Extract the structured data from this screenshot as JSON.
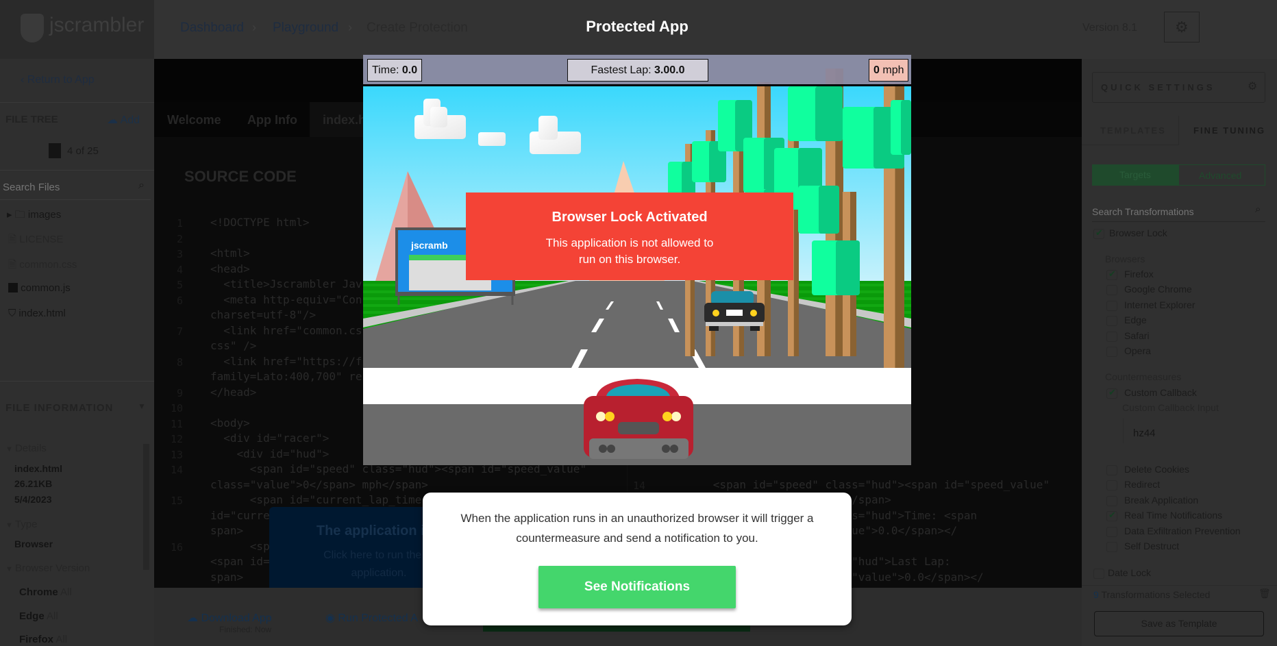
{
  "header": {
    "logo_text": "jscrambler",
    "breadcrumbs": [
      "Dashboard",
      "Playground",
      "Create Protection"
    ],
    "version": "Version 8.1"
  },
  "sidebar": {
    "return_label": "Return to App",
    "file_tree_title": "FILE TREE",
    "add_label": "Add",
    "file_count": "4 of 25",
    "search_placeholder": "Search Files",
    "files": [
      "images",
      "LICENSE",
      "common.css",
      "common.js",
      "index.html"
    ],
    "file_info_title": "FILE INFORMATION",
    "details_label": "Details",
    "details": [
      "index.html",
      "26.21KB",
      "5/4/2023"
    ],
    "type_label": "Type",
    "type_value": "Browser",
    "browser_version_label": "Browser Version",
    "versions": [
      {
        "name": "Chrome",
        "value": "All"
      },
      {
        "name": "Edge",
        "value": "All"
      },
      {
        "name": "Firefox",
        "value": "All"
      }
    ]
  },
  "main": {
    "tabs": [
      "Welcome",
      "App Info",
      "index.h"
    ],
    "section_title": "SOURCE CODE",
    "left_code": [
      {
        "n": "1",
        "t": "<!DOCTYPE html>"
      },
      {
        "n": "2",
        "t": ""
      },
      {
        "n": "3",
        "t": "<html>"
      },
      {
        "n": "4",
        "t": "<head>"
      },
      {
        "n": "5",
        "t": "  <title>Jscrambler Jav"
      },
      {
        "n": "6",
        "t": "  <meta http-equiv=\"Con"
      },
      {
        "n": "",
        "t": "charset=utf-8\"/>"
      },
      {
        "n": "7",
        "t": "  <link href=\"common.cs"
      },
      {
        "n": "",
        "t": "css\" />"
      },
      {
        "n": "8",
        "t": "  <link href=\"https://f"
      },
      {
        "n": "",
        "t": "family=Lato:400,700\" re"
      },
      {
        "n": "9",
        "t": "</head>"
      },
      {
        "n": "10",
        "t": ""
      },
      {
        "n": "11",
        "t": "<body>"
      },
      {
        "n": "12",
        "t": "  <div id=\"racer\">"
      },
      {
        "n": "13",
        "t": "    <div id=\"hud\">"
      },
      {
        "n": "14",
        "t": "      <span id=\"speed\" class=\"hud\"><span id=\"speed_value\""
      },
      {
        "n": "",
        "t": "class=\"value\">0</span> mph</span>"
      },
      {
        "n": "15",
        "t": "      <span id=\"current_lap_time"
      },
      {
        "n": "",
        "t": "id=\"curre"
      },
      {
        "n": "",
        "t": "span>"
      },
      {
        "n": "16",
        "t": "      <sp"
      },
      {
        "n": "",
        "t": "<span id="
      },
      {
        "n": "",
        "t": "span>"
      }
    ],
    "right_code": [
      {
        "row": 5,
        "n": "",
        "t": "r</title>"
      },
      {
        "row": 6,
        "n": "",
        "t": "ontent=\"text/html;"
      },
      {
        "row": 8,
        "n": "",
        "t": "esheet\" type=\"text/"
      },
      {
        "row": 10,
        "n": "",
        "t": "pis.com/css?"
      },
      {
        "row": 11,
        "n": "",
        "t": "t\">"
      },
      {
        "row": 17,
        "n": "14",
        "t": "      <span id=\"speed\" class=\"hud\"><span id=\"speed_value\""
      },
      {
        "row": 18,
        "n": "",
        "t": "class=\"value\">0</span> mph</span>"
      },
      {
        "row": 19,
        "n": "",
        "t": "                _time\" class=\"hud\">Time: <span"
      },
      {
        "row": 20,
        "n": "",
        "t": "                 class=\"value\">0.0</span></"
      },
      {
        "row": 22,
        "n": "",
        "t": "                 me\" class=\"hud\">Last Lap:"
      },
      {
        "row": 23,
        "n": "",
        "t": "                 ue\" class=\"value\">0.0</span></"
      }
    ],
    "tooltip": {
      "title": "The application is r",
      "line1": "Click here to run the pr",
      "line2": "application."
    },
    "download_label": "Download App",
    "download_status": "Finished: Now",
    "run_label": "Run Protected A"
  },
  "right_panel": {
    "quick_settings": "QUICK SETTINGS",
    "tabs": [
      "TEMPLATES",
      "FINE TUNING"
    ],
    "toggle": [
      "Targets",
      "Advanced"
    ],
    "search_placeholder": "Search Transformations",
    "browser_lock": "Browser Lock",
    "browsers_label": "Browsers",
    "browsers": [
      {
        "label": "Firefox",
        "checked": true
      },
      {
        "label": "Google Chrome",
        "checked": false
      },
      {
        "label": "Internet Explorer",
        "checked": false
      },
      {
        "label": "Edge",
        "checked": false
      },
      {
        "label": "Safari",
        "checked": false
      },
      {
        "label": "Opera",
        "checked": false
      }
    ],
    "countermeasures_label": "Countermeasures",
    "custom_callback": "Custom Callback",
    "custom_callback_input_label": "Custom Callback Input",
    "custom_callback_value": "hz44",
    "countermeasures": [
      {
        "label": "Delete Cookies",
        "checked": false
      },
      {
        "label": "Redirect",
        "checked": false
      },
      {
        "label": "Break Application",
        "checked": false
      },
      {
        "label": "Real Time Notifications",
        "checked": true
      },
      {
        "label": "Data Exfiltration Prevention",
        "checked": false
      },
      {
        "label": "Self Destruct",
        "checked": false
      }
    ],
    "date_lock": "Date Lock",
    "selected_count": "9",
    "selected_label": "Transformations Selected",
    "save_template": "Save as Template"
  },
  "modal": {
    "title": "Protected App",
    "hud": {
      "time_label": "Time:",
      "time_value": "0.0",
      "fastest_label": "Fastest Lap:",
      "fastest_value": "3.00.0",
      "speed_value": "0",
      "speed_unit": "mph"
    },
    "billboard_text": "jscramb",
    "lock_title": "Browser Lock Activated",
    "lock_line1": "This application is not allowed to",
    "lock_line2": "run on this browser.",
    "card_line1": "When the application runs in an unauthorized browser it will trigger a",
    "card_line2": "countermeasure and send a notification to you.",
    "button": "See Notifications"
  },
  "colors": {
    "lock_red": "#f44336",
    "button_green": "#44d66c",
    "accent_green": "#1f7a3f"
  }
}
